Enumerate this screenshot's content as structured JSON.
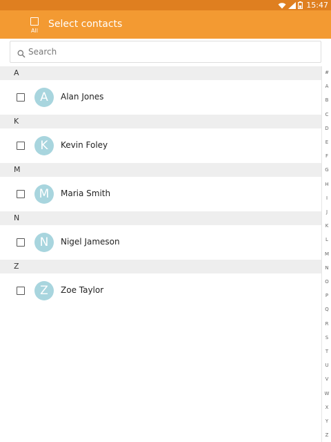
{
  "status_bar": {
    "time": "15:47",
    "icons": [
      "wifi-icon",
      "signal-icon",
      "battery-icon"
    ]
  },
  "app_bar": {
    "select_all_label": "All",
    "title": "Select contacts"
  },
  "search": {
    "placeholder": "Search"
  },
  "sections": [
    {
      "letter": "A",
      "contacts": [
        {
          "initial": "A",
          "name": "Alan Jones"
        }
      ]
    },
    {
      "letter": "K",
      "contacts": [
        {
          "initial": "K",
          "name": "Kevin Foley"
        }
      ]
    },
    {
      "letter": "M",
      "contacts": [
        {
          "initial": "M",
          "name": "Maria Smith"
        }
      ]
    },
    {
      "letter": "N",
      "contacts": [
        {
          "initial": "N",
          "name": "Nigel Jameson"
        }
      ]
    },
    {
      "letter": "Z",
      "contacts": [
        {
          "initial": "Z",
          "name": "Zoe Taylor"
        }
      ]
    }
  ],
  "index_letters": [
    "#",
    "A",
    "B",
    "C",
    "D",
    "E",
    "F",
    "G",
    "H",
    "I",
    "J",
    "K",
    "L",
    "M",
    "N",
    "O",
    "P",
    "Q",
    "R",
    "S",
    "T",
    "U",
    "V",
    "W",
    "X",
    "Y",
    "Z"
  ],
  "colors": {
    "status_bar": "#df7f20",
    "app_bar": "#f39a32",
    "avatar": "#a8d5de",
    "section_header": "#eeeeee"
  }
}
